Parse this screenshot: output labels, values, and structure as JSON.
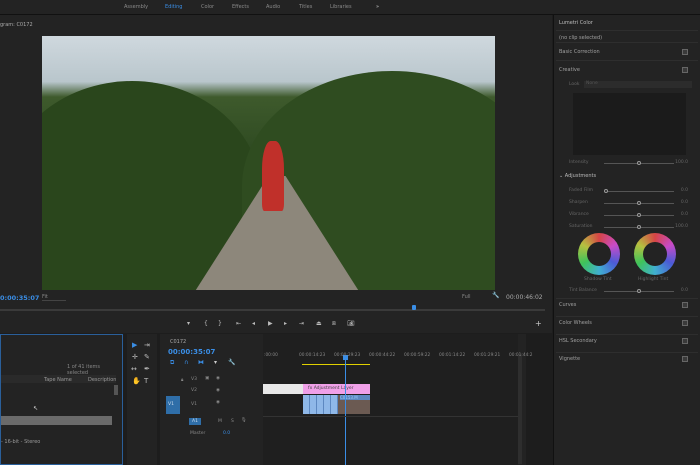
{
  "workspaces": [
    {
      "label": "Assembly",
      "active": false
    },
    {
      "label": "Editing",
      "active": true
    },
    {
      "label": "Color",
      "active": false
    },
    {
      "label": "Effects",
      "active": false
    },
    {
      "label": "Audio",
      "active": false
    },
    {
      "label": "Titles",
      "active": false
    },
    {
      "label": "Libraries",
      "active": false
    }
  ],
  "workspace_more": "»",
  "program": {
    "title": "gram: C0172",
    "timecode": "0:00:35:07",
    "fit": "Fit",
    "quality": "Full",
    "duration": "00:00:46:02",
    "playhead_fraction": 0.76
  },
  "transport": [
    "add-marker",
    "mark-in",
    "mark-out",
    "go-to-in",
    "step-back",
    "play",
    "step-forward",
    "go-to-out",
    "lift",
    "extract",
    "export-frame"
  ],
  "lumetri": {
    "title": "Lumetri Color",
    "clip": "(no clip selected)",
    "basic": "Basic Correction",
    "creative": "Creative",
    "look_label": "Look",
    "look_value": "None",
    "intensity_label": "Intensity",
    "intensity": "100.0",
    "adjustments": "Adjustments",
    "sliders": [
      {
        "label": "Faded Film",
        "value": "0.0",
        "pos": 0
      },
      {
        "label": "Sharpen",
        "value": "0.0",
        "pos": 0.5
      },
      {
        "label": "Vibrance",
        "value": "0.0",
        "pos": 0.5
      },
      {
        "label": "Saturation",
        "value": "100.0",
        "pos": 0.5
      }
    ],
    "shadow_tint": "Shadow Tint",
    "highlight_tint": "Highlight Tint",
    "tint_balance_label": "Tint Balance",
    "tint_balance": "0.0",
    "sections": [
      "Curves",
      "Color Wheels",
      "HSL Secondary",
      "Vignette"
    ]
  },
  "project": {
    "selection": "1 of 41 items selected",
    "col_tape": "Tape Name",
    "col_desc": "Description",
    "audio_info": "- 16-bit - Stereo"
  },
  "timeline": {
    "sequence": "C0172",
    "timecode": "00:00:35:07",
    "ruler": [
      ":00:00",
      "00:00:14:23",
      "00:00:29:23",
      "00:00:44:22",
      "00:00:59:22",
      "00:01:14:22",
      "00:01:29:21",
      "00:01:44:2"
    ],
    "tracks": {
      "v3": "V3",
      "v2": "V2",
      "v1": "V1",
      "v1_src": "V1",
      "a1": "A1",
      "m": "M",
      "s": "S",
      "master": "Master",
      "master_val": "0.0"
    },
    "clip_adjust": "Adjustment Layer",
    "clip_video": "C0153.M"
  }
}
